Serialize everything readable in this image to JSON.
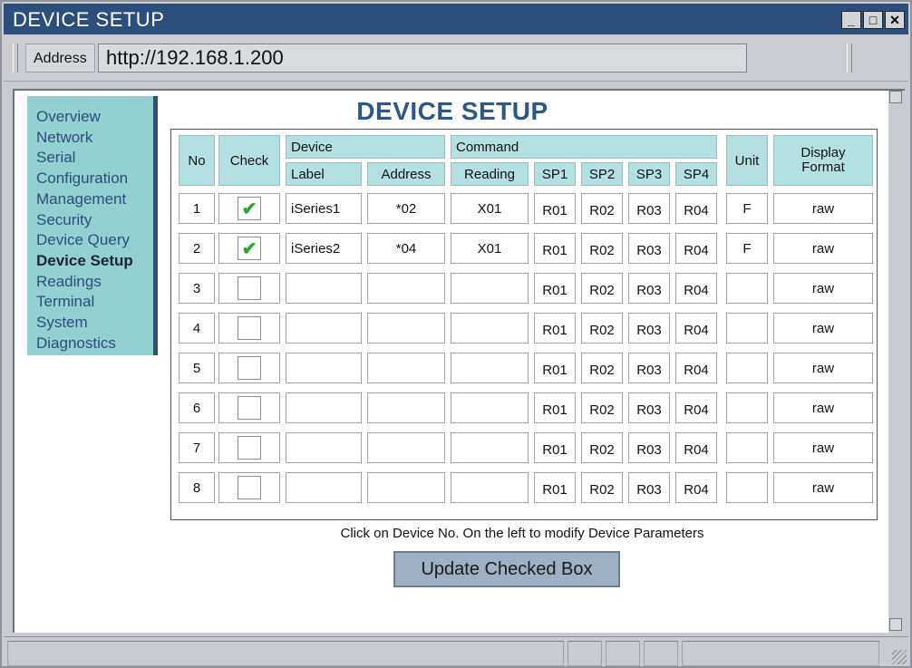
{
  "window": {
    "title": "DEVICE SETUP",
    "min": "_",
    "max": "□",
    "close": "✕"
  },
  "address": {
    "label": "Address",
    "url": "http://192.168.1.200",
    "drop": "▼"
  },
  "nav": [
    {
      "label": "Overview",
      "active": false
    },
    {
      "label": "Network",
      "active": false
    },
    {
      "label": "Serial",
      "active": false
    },
    {
      "label": "Configuration",
      "active": false
    },
    {
      "label": "Management",
      "active": false
    },
    {
      "label": "Security",
      "active": false
    },
    {
      "label": "Device Query",
      "active": false
    },
    {
      "label": "Device Setup",
      "active": true
    },
    {
      "label": "Readings",
      "active": false
    },
    {
      "label": "Terminal",
      "active": false
    },
    {
      "label": "System",
      "active": false
    },
    {
      "label": "Diagnostics",
      "active": false
    }
  ],
  "page": {
    "title": "DEVICE SETUP"
  },
  "table": {
    "headers": {
      "no": "No",
      "check": "Check",
      "device": "Device",
      "label": "Label",
      "address": "Address",
      "command": "Command",
      "reading": "Reading",
      "sp1": "SP1",
      "sp2": "SP2",
      "sp3": "SP3",
      "sp4": "SP4",
      "unit": "Unit",
      "display1": "Display",
      "display2": "Format"
    },
    "rows": [
      {
        "no": "1",
        "checked": true,
        "label": "iSeries1",
        "address": "*02",
        "reading": "X01",
        "sp1": "R01",
        "sp2": "R02",
        "sp3": "R03",
        "sp4": "R04",
        "unit": "F",
        "format": "raw"
      },
      {
        "no": "2",
        "checked": true,
        "label": "iSeries2",
        "address": "*04",
        "reading": "X01",
        "sp1": "R01",
        "sp2": "R02",
        "sp3": "R03",
        "sp4": "R04",
        "unit": "F",
        "format": "raw"
      },
      {
        "no": "3",
        "checked": false,
        "label": "",
        "address": "",
        "reading": "",
        "sp1": "R01",
        "sp2": "R02",
        "sp3": "R03",
        "sp4": "R04",
        "unit": "",
        "format": "raw"
      },
      {
        "no": "4",
        "checked": false,
        "label": "",
        "address": "",
        "reading": "",
        "sp1": "R01",
        "sp2": "R02",
        "sp3": "R03",
        "sp4": "R04",
        "unit": "",
        "format": "raw"
      },
      {
        "no": "5",
        "checked": false,
        "label": "",
        "address": "",
        "reading": "",
        "sp1": "R01",
        "sp2": "R02",
        "sp3": "R03",
        "sp4": "R04",
        "unit": "",
        "format": "raw"
      },
      {
        "no": "6",
        "checked": false,
        "label": "",
        "address": "",
        "reading": "",
        "sp1": "R01",
        "sp2": "R02",
        "sp3": "R03",
        "sp4": "R04",
        "unit": "",
        "format": "raw"
      },
      {
        "no": "7",
        "checked": false,
        "label": "",
        "address": "",
        "reading": "",
        "sp1": "R01",
        "sp2": "R02",
        "sp3": "R03",
        "sp4": "R04",
        "unit": "",
        "format": "raw"
      },
      {
        "no": "8",
        "checked": false,
        "label": "",
        "address": "",
        "reading": "",
        "sp1": "R01",
        "sp2": "R02",
        "sp3": "R03",
        "sp4": "R04",
        "unit": "",
        "format": "raw"
      }
    ]
  },
  "note": "Click on Device No. On the left to modify Device Parameters",
  "update_button": "Update Checked Box",
  "colors": {
    "titlebar": "#2b4f7a",
    "sidebar": "#93d0d0",
    "header": "#b3e1e1",
    "check": "#2aa836",
    "button": "#9fb0c2"
  },
  "icons": {
    "check": "✔",
    "scroll_up": "scroll-up-arrow",
    "scroll_down": "scroll-down-arrow",
    "resize": "resize-grip"
  }
}
